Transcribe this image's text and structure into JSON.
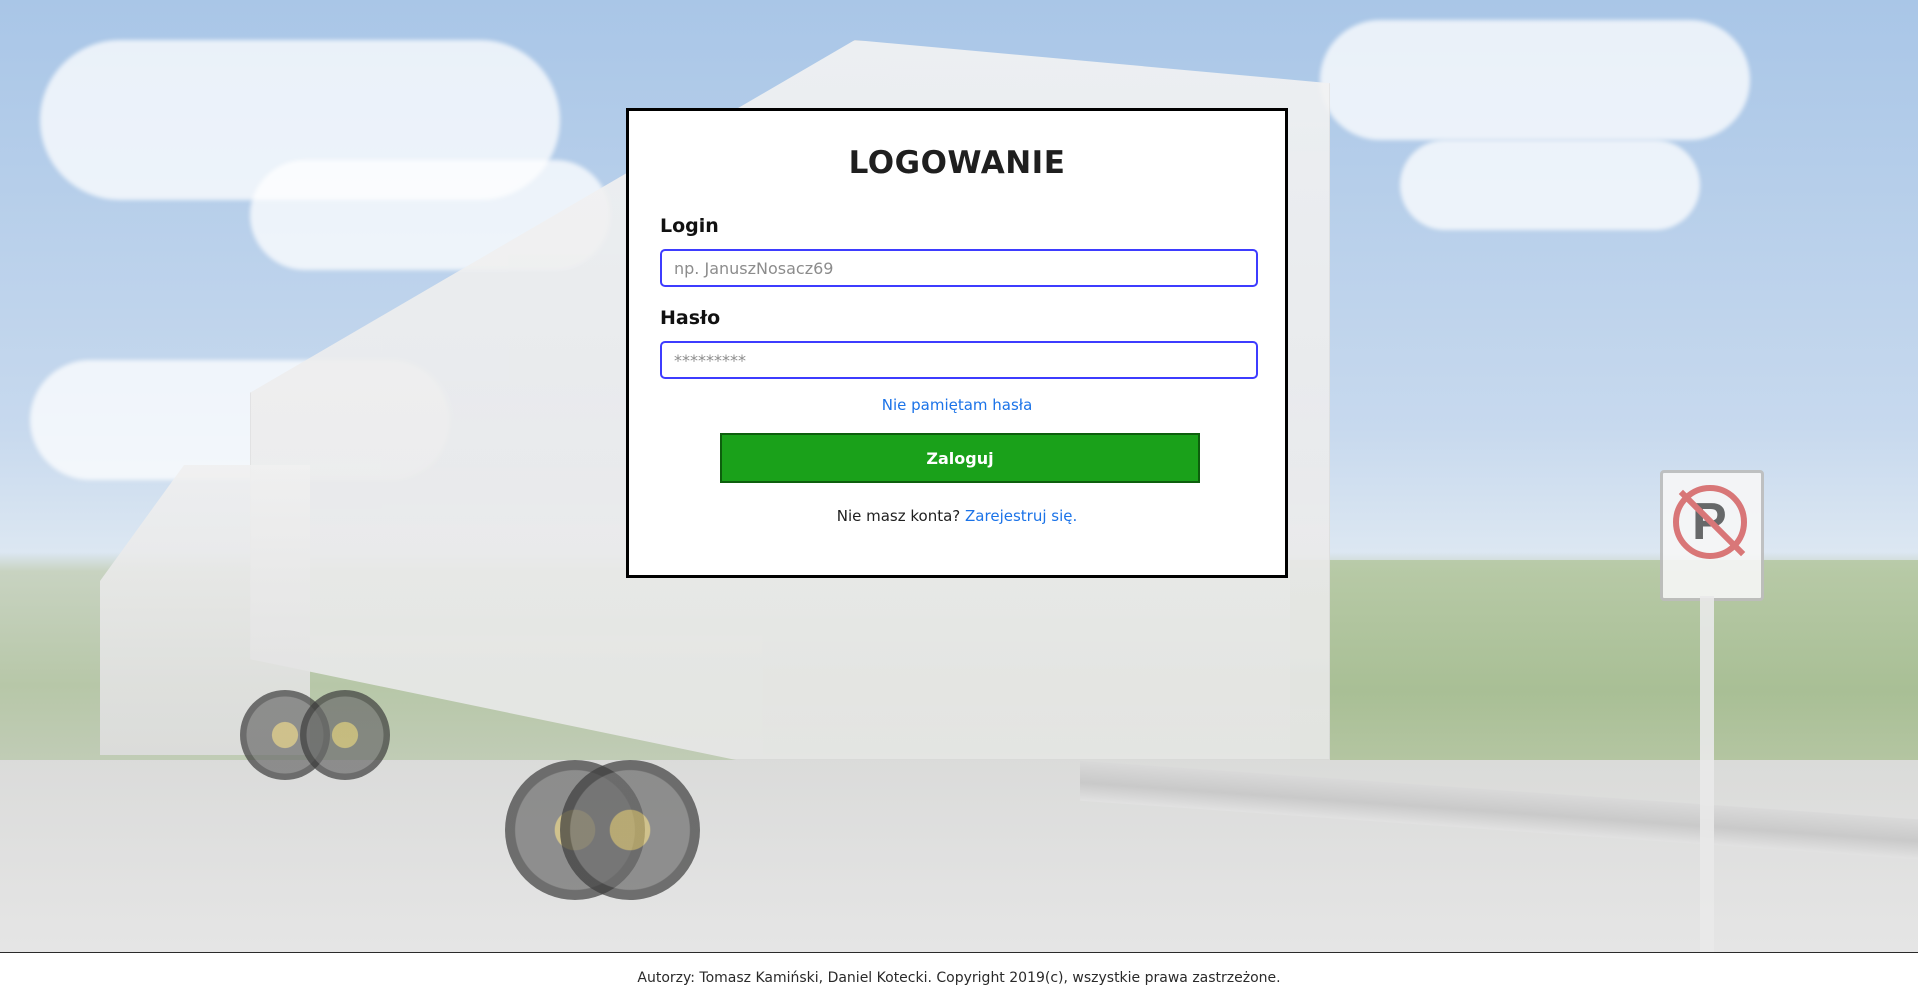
{
  "login_form": {
    "title": "LOGOWANIE",
    "login_label": "Login",
    "login_placeholder": "np. JanuszNosacz69",
    "login_value": "",
    "password_label": "Hasło",
    "password_placeholder": "*********",
    "password_value": "",
    "forgot_password_link": "Nie pamiętam hasła",
    "submit_button": "Zaloguj",
    "register_prompt": "Nie masz konta?",
    "register_link": "Zarejestruj się."
  },
  "footer": {
    "text": "Autorzy: Tomasz Kamiński, Daniel Kotecki. Copyright 2019(c), wszystkie prawa zastrzeżone."
  },
  "colors": {
    "input_border": "#3e3cff",
    "link": "#1b73e8",
    "submit_bg": "#1aa11a",
    "card_border": "#000000"
  },
  "icons": {
    "no_parking_sign": "no-parking-icon"
  }
}
